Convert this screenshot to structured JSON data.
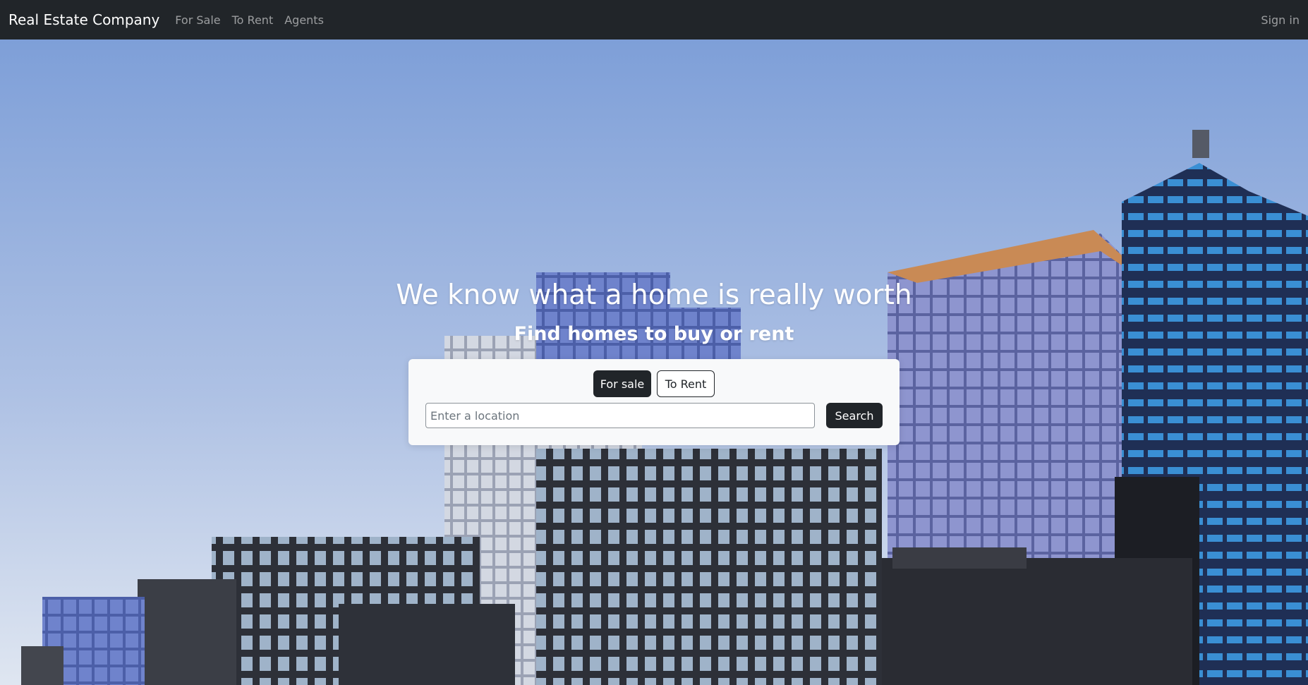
{
  "navbar": {
    "brand": "Real Estate Company",
    "links": [
      "For Sale",
      "To Rent",
      "Agents"
    ],
    "sign_in": "Sign in"
  },
  "hero": {
    "title": "We know what a home is really worth",
    "subtitle": "Find homes to buy or rent"
  },
  "search": {
    "toggle_for_sale": "For sale",
    "toggle_to_rent": "To Rent",
    "active_toggle": "For sale",
    "location_placeholder": "Enter a location",
    "location_value": "",
    "button_label": "Search"
  },
  "colors": {
    "navbar_bg": "#212529",
    "button_dark": "#212529",
    "card_bg": "#f8f9fa",
    "sky_top": "#7e9fd8",
    "sky_bottom": "#d8e1ef"
  },
  "background": {
    "image": "city-skyscrapers-photo"
  }
}
